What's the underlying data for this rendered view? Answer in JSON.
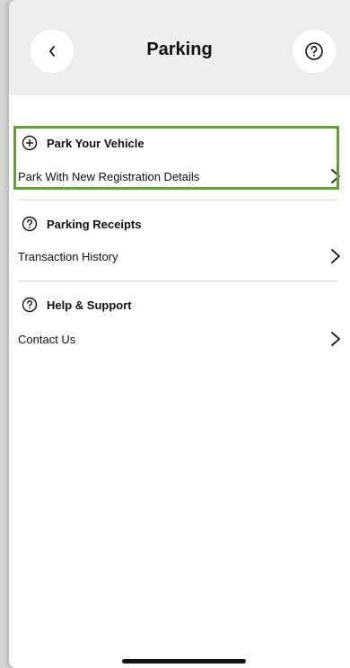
{
  "header": {
    "title": "Parking",
    "back_icon": "chevron-left-icon",
    "help_icon": "question-circle-icon"
  },
  "sections": [
    {
      "title": "Park Your Vehicle",
      "icon": "plus-circle-icon",
      "item_label": "Park With New Registration Details",
      "highlighted": true
    },
    {
      "title": "Parking Receipts",
      "icon": "question-circle-icon",
      "item_label": "Transaction History",
      "highlighted": false
    },
    {
      "title": "Help & Support",
      "icon": "question-circle-icon",
      "item_label": "Contact Us",
      "highlighted": false
    }
  ],
  "colors": {
    "highlight_border": "#62a13a",
    "header_bg": "#eeeeee"
  }
}
